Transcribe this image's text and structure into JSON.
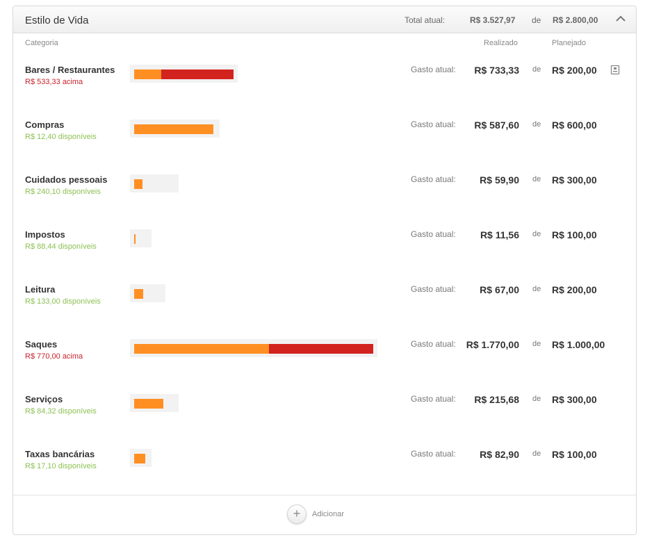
{
  "section": {
    "title": "Estilo de Vida",
    "total_label": "Total atual:",
    "total_value": "R$ 3.527,97",
    "de": "de",
    "planned_total": "R$ 2.800,00",
    "collapse_icon": "chevron-up-icon"
  },
  "columns": {
    "category": "Categoria",
    "realized": "Realizado",
    "planned": "Planejado"
  },
  "spent_label": "Gasto atual:",
  "de": "de",
  "colors": {
    "spent_bar": "#ff8f23",
    "over_bar": "#d2231f",
    "over_text": "#c7232b",
    "available_text": "#8cc152"
  },
  "categories": [
    {
      "name": "Bares / Restaurantes",
      "status": "R$ 533,33 acima",
      "status_type": "over",
      "spent": "R$ 733,33",
      "planned": "R$ 200,00",
      "spent_num": 733.33,
      "planned_num": 200.0,
      "has_note": true
    },
    {
      "name": "Compras",
      "status": "R$ 12,40 disponíveis",
      "status_type": "available",
      "spent": "R$ 587,60",
      "planned": "R$ 600,00",
      "spent_num": 587.6,
      "planned_num": 600.0,
      "has_note": false
    },
    {
      "name": "Cuidados pessoais",
      "status": "R$ 240,10 disponíveis",
      "status_type": "available",
      "spent": "R$ 59,90",
      "planned": "R$ 300,00",
      "spent_num": 59.9,
      "planned_num": 300.0,
      "has_note": false
    },
    {
      "name": "Impostos",
      "status": "R$ 88,44 disponíveis",
      "status_type": "available",
      "spent": "R$ 11,56",
      "planned": "R$ 100,00",
      "spent_num": 11.56,
      "planned_num": 100.0,
      "has_note": false
    },
    {
      "name": "Leitura",
      "status": "R$ 133,00 disponíveis",
      "status_type": "available",
      "spent": "R$ 67,00",
      "planned": "R$ 200,00",
      "spent_num": 67.0,
      "planned_num": 200.0,
      "has_note": false
    },
    {
      "name": "Saques",
      "status": "R$ 770,00 acima",
      "status_type": "over",
      "spent": "R$ 1.770,00",
      "planned": "R$ 1.000,00",
      "spent_num": 1770.0,
      "planned_num": 1000.0,
      "has_note": false
    },
    {
      "name": "Serviços",
      "status": "R$ 84,32 disponíveis",
      "status_type": "available",
      "spent": "R$ 215,68",
      "planned": "R$ 300,00",
      "spent_num": 215.68,
      "planned_num": 300.0,
      "has_note": false
    },
    {
      "name": "Taxas bancárias",
      "status": "R$ 17,10 disponíveis",
      "status_type": "available",
      "spent": "R$ 82,90",
      "planned": "R$ 100,00",
      "spent_num": 82.9,
      "planned_num": 100.0,
      "has_note": false
    }
  ],
  "footer": {
    "add_label": "Adicionar",
    "add_icon": "plus-icon"
  }
}
